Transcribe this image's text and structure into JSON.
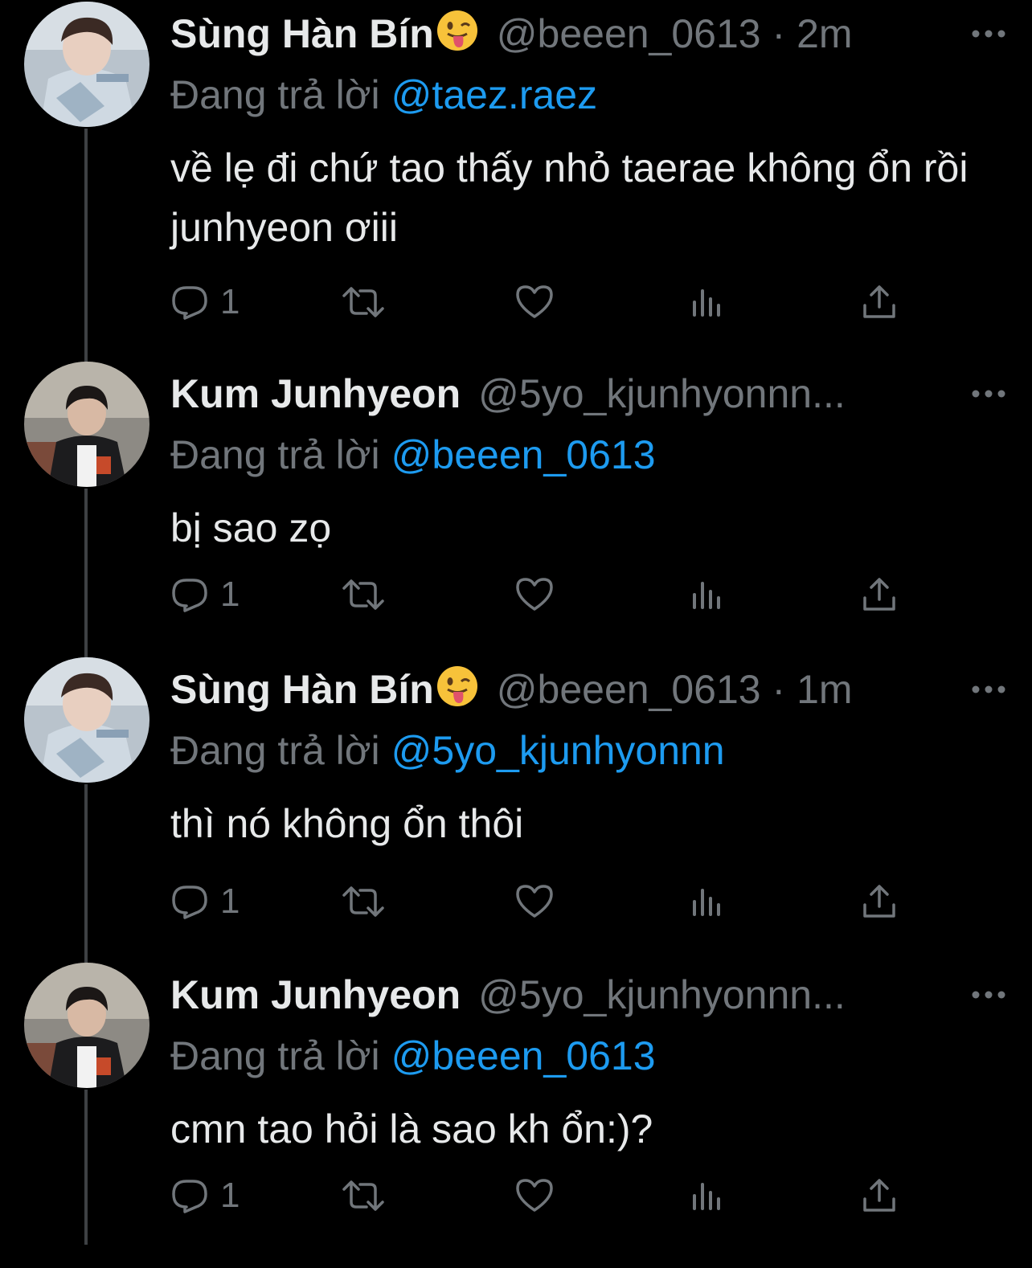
{
  "colors": {
    "background": "#000000",
    "text": "#e7e9ea",
    "muted": "#71767b",
    "link": "#1d9bf0",
    "thread_line": "#3e4144"
  },
  "reply_prefix": "Đang trả lời",
  "tweets": [
    {
      "display_name": "Sùng Hàn Bín",
      "emoji": "face-with-tongue",
      "handle": "@beeen_0613",
      "separator": "·",
      "time": "2m",
      "reply_to": "@taez.raez",
      "text": "về lẹ đi chứ tao thấy nhỏ taerae không ổn rồi junhyeon ơiii",
      "reply_count": "1"
    },
    {
      "display_name": "Kum Junhyeon",
      "emoji": "",
      "handle": "@5yo_kjunhyonnn...",
      "separator": "",
      "time": "",
      "reply_to": "@beeen_0613",
      "text": "bị sao zọ",
      "reply_count": "1"
    },
    {
      "display_name": "Sùng Hàn Bín",
      "emoji": "face-with-tongue",
      "handle": "@beeen_0613",
      "separator": "·",
      "time": "1m",
      "reply_to": "@5yo_kjunhyonnn",
      "text": "thì nó không ổn thôi",
      "reply_count": "1"
    },
    {
      "display_name": "Kum Junhyeon",
      "emoji": "",
      "handle": "@5yo_kjunhyonnn...",
      "separator": "",
      "time": "",
      "reply_to": "@beeen_0613",
      "text": "cmn tao hỏi là sao kh ổn:)?",
      "reply_count": "1"
    }
  ],
  "icons": {
    "reply": "reply-icon",
    "retweet": "retweet-icon",
    "like": "heart-icon",
    "views": "views-icon",
    "share": "share-icon",
    "more": "more-options-icon"
  }
}
